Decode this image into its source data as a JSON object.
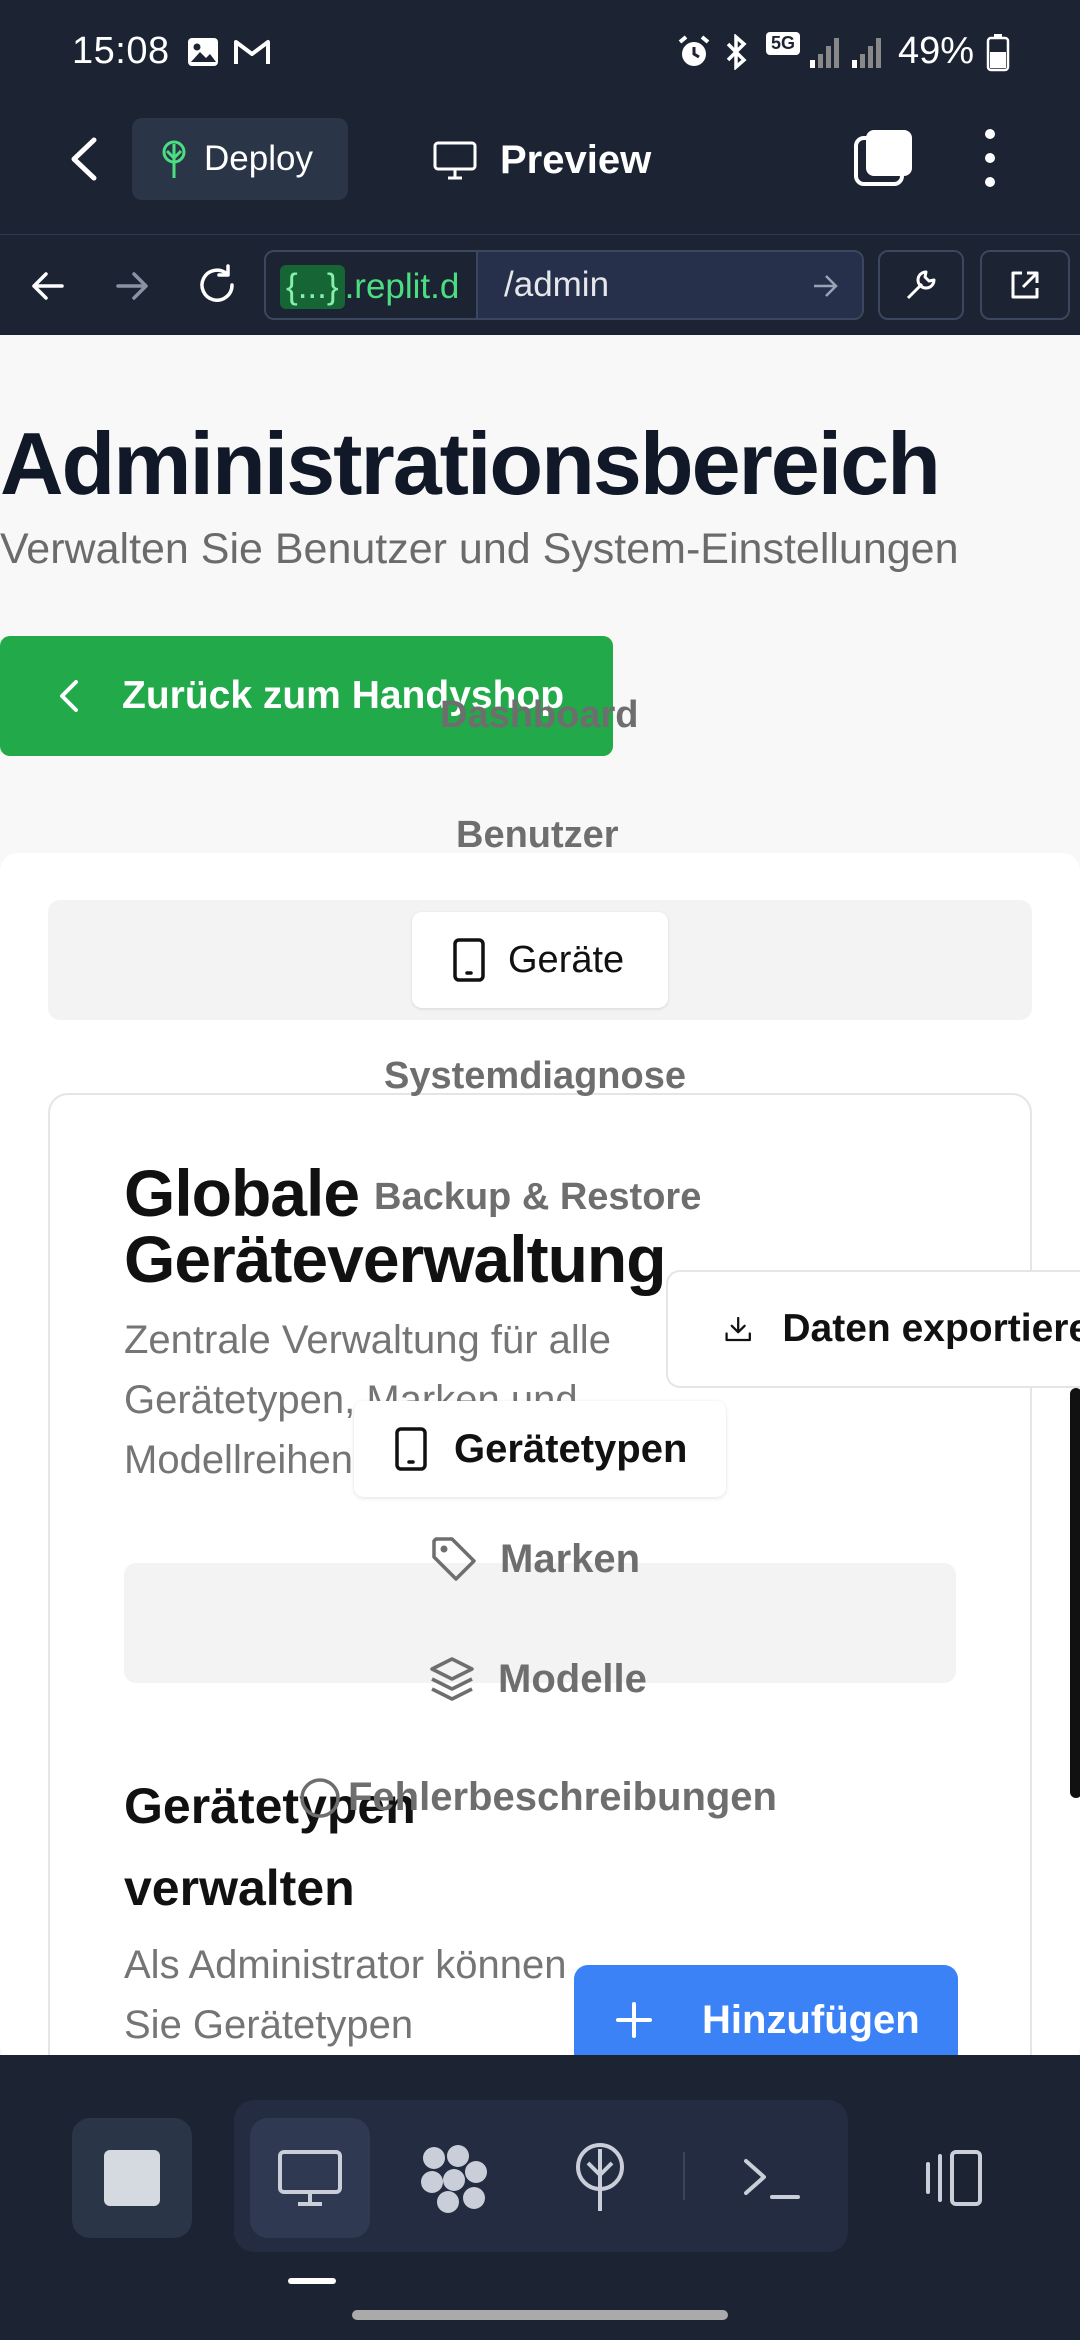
{
  "status_bar": {
    "time": "15:08",
    "battery": "49%",
    "network": "5G"
  },
  "app_bar": {
    "deploy_label": "Deploy",
    "preview_label": "Preview"
  },
  "url_bar": {
    "host_badge": "{...}",
    "host": ".replit.d",
    "path": "/admin"
  },
  "page": {
    "title": "Administrationsbereich",
    "subtitle": "Verwalten Sie Benutzer und System-Einstellungen",
    "back_button": "Zurück zum Handyshop",
    "menu": {
      "dashboard": "Dashboard",
      "benutzer": "Benutzer",
      "geraete": "Geräte",
      "systemdiagnose": "Systemdiagnose",
      "backup": "Backup & Restore"
    },
    "card": {
      "title": "Globale Geräteverwaltung",
      "description": "Zentrale Verwaltung für alle Gerätetypen, Marken und Modellreihen",
      "export_button": "Daten exportieren",
      "subtabs": {
        "geraetetypen": "Gerätetypen",
        "marken": "Marken",
        "modelle": "Modelle",
        "fehler": "Fehlerbeschreibungen"
      },
      "section_title": "Gerätetypen verwalten",
      "section_description": "Als Administrator können Sie Gerätetypen",
      "add_button": "Hinzufügen"
    }
  },
  "colors": {
    "dark_bg": "#1c2333",
    "green_button": "#22a94a",
    "blue_button": "#3b82f6",
    "url_green": "#4ade80"
  }
}
